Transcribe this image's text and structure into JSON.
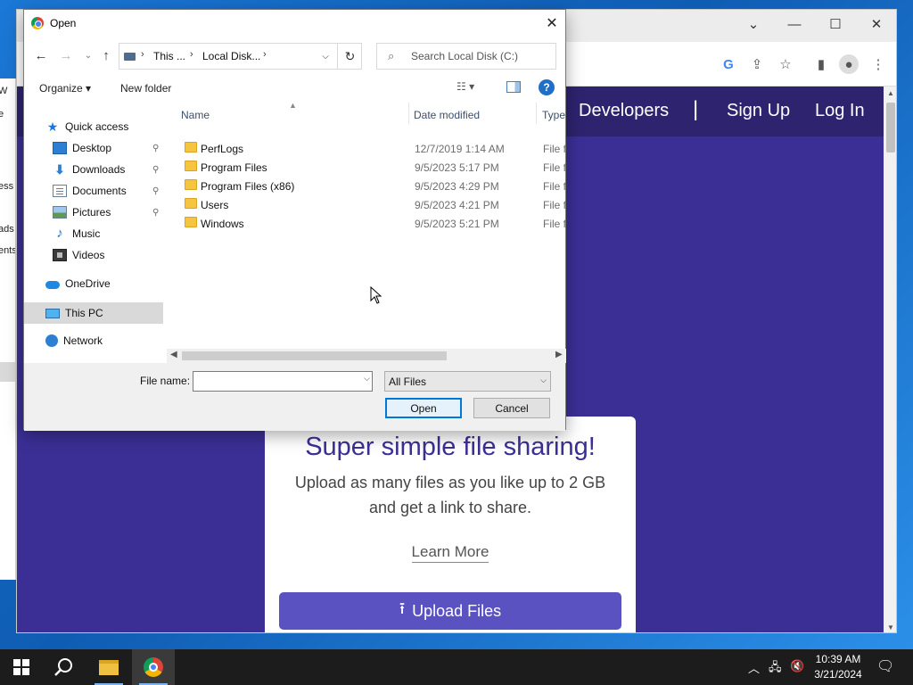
{
  "browser": {
    "tab_caret": "⌄",
    "minimize": "—",
    "maximize": "☐",
    "close": "✕",
    "toolbar_icons": [
      "google-icon",
      "share-icon",
      "star-icon",
      "sidepanel-icon",
      "profile-icon",
      "menu-icon"
    ]
  },
  "explorer_fragments": [
    "e",
    "W",
    "ess",
    "ads",
    "ents"
  ],
  "site": {
    "nav": {
      "developers": "Developers",
      "separator": "|",
      "signup": "Sign Up",
      "login": "Log In"
    },
    "hero": {
      "title": "Super simple file sharing!",
      "subtitle": "Upload as many files as you like up to 2 GB and get a link to share.",
      "learn_more": "Learn More",
      "upload_button": "Upload Files"
    },
    "colors": {
      "site_bg": "#3b2f96",
      "nav_bg": "#2e236f",
      "upload_btn": "#5b52c2"
    }
  },
  "dialog": {
    "title": "Open",
    "close": "✕",
    "nav": {
      "back": "←",
      "forward": "→",
      "recent": "⌄",
      "up": "↑"
    },
    "breadcrumb": [
      "This ...",
      "Local Disk..."
    ],
    "breadcrumb_sep": "›",
    "search_placeholder": "Search Local Disk (C:)",
    "commands": {
      "organize": "Organize ▾",
      "new_folder": "New folder",
      "view": "☷ ▾",
      "help": "?"
    },
    "nav_pane": {
      "quick_access": "Quick access",
      "items": [
        {
          "label": "Desktop",
          "icon": "desktop-icon",
          "pinned": true
        },
        {
          "label": "Downloads",
          "icon": "downloads-icon",
          "pinned": true
        },
        {
          "label": "Documents",
          "icon": "documents-icon",
          "pinned": true
        },
        {
          "label": "Pictures",
          "icon": "pictures-icon",
          "pinned": true
        },
        {
          "label": "Music",
          "icon": "music-icon",
          "pinned": false
        },
        {
          "label": "Videos",
          "icon": "videos-icon",
          "pinned": false
        }
      ],
      "onedrive": "OneDrive",
      "this_pc": "This PC",
      "network": "Network",
      "pin_glyph": "📌"
    },
    "columns": {
      "name": "Name",
      "date": "Date modified",
      "type": "Type"
    },
    "files": [
      {
        "name": "PerfLogs",
        "date": "12/7/2019 1:14 AM",
        "type": "File fo"
      },
      {
        "name": "Program Files",
        "date": "9/5/2023 5:17 PM",
        "type": "File fo"
      },
      {
        "name": "Program Files (x86)",
        "date": "9/5/2023 4:29 PM",
        "type": "File fo"
      },
      {
        "name": "Users",
        "date": "9/5/2023 4:21 PM",
        "type": "File fo"
      },
      {
        "name": "Windows",
        "date": "9/5/2023 5:21 PM",
        "type": "File fo"
      }
    ],
    "file_name_label": "File name:",
    "file_name_value": "",
    "file_type": "All Files",
    "open_button": "Open",
    "cancel_button": "Cancel"
  },
  "taskbar": {
    "clock_time": "10:39 AM",
    "clock_date": "3/21/2024",
    "apps": [
      "start-icon",
      "search-icon",
      "file-explorer-icon",
      "chrome-icon"
    ]
  }
}
